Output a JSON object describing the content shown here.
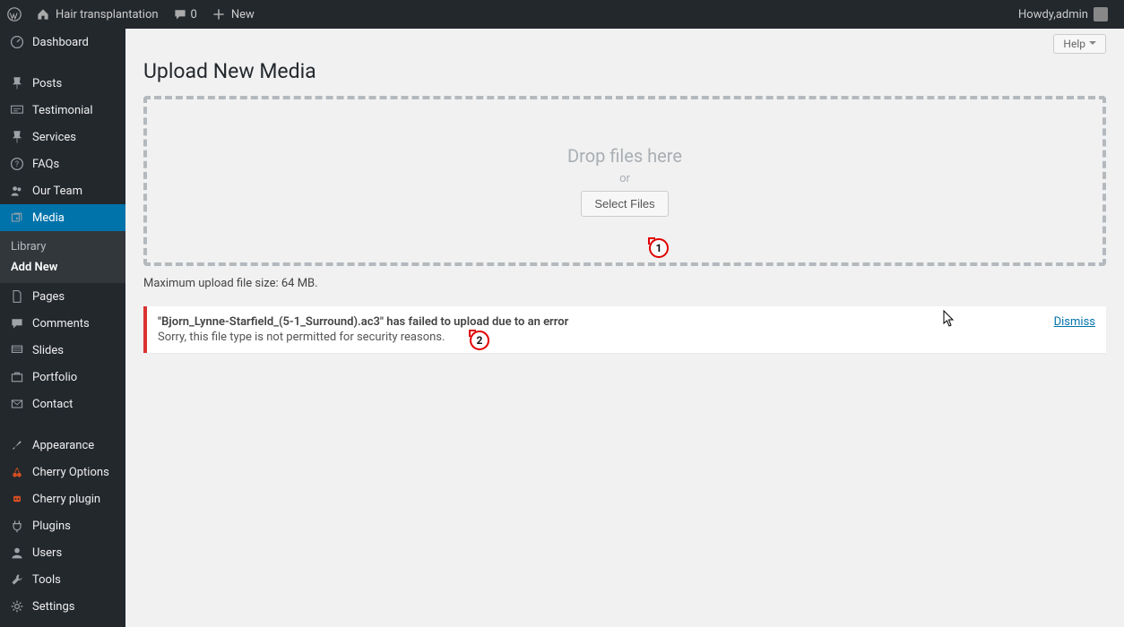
{
  "adminbar": {
    "site_name": "Hair transplantation",
    "comments_count": "0",
    "new_label": "New",
    "howdy_prefix": "Howdy, ",
    "username": "admin"
  },
  "sidebar": {
    "items": [
      {
        "label": "Dashboard",
        "icon": "dashboard"
      },
      {
        "sep": true
      },
      {
        "label": "Posts",
        "icon": "pin"
      },
      {
        "label": "Testimonial",
        "icon": "quote"
      },
      {
        "label": "Services",
        "icon": "pin"
      },
      {
        "label": "FAQs",
        "icon": "help"
      },
      {
        "label": "Our Team",
        "icon": "users"
      },
      {
        "label": "Media",
        "icon": "media",
        "current": true
      },
      {
        "label": "Pages",
        "icon": "page"
      },
      {
        "label": "Comments",
        "icon": "comment"
      },
      {
        "label": "Slides",
        "icon": "slides"
      },
      {
        "label": "Portfolio",
        "icon": "portfolio"
      },
      {
        "label": "Contact",
        "icon": "mail"
      },
      {
        "sep": true
      },
      {
        "label": "Appearance",
        "icon": "brush"
      },
      {
        "label": "Cherry Options",
        "icon": "cherry",
        "tint": "red"
      },
      {
        "label": "Cherry plugin",
        "icon": "cherryplug",
        "tint": "red"
      },
      {
        "label": "Plugins",
        "icon": "plug"
      },
      {
        "label": "Users",
        "icon": "user"
      },
      {
        "label": "Tools",
        "icon": "tools"
      },
      {
        "label": "Settings",
        "icon": "settings"
      }
    ],
    "submenu": [
      {
        "label": "Library"
      },
      {
        "label": "Add New",
        "current": true
      }
    ]
  },
  "page": {
    "help_label": "Help",
    "title": "Upload New Media",
    "dropzone_main": "Drop files here",
    "dropzone_or": "or",
    "select_files_label": "Select Files",
    "max_size_text": "Maximum upload file size: 64 MB."
  },
  "error": {
    "title": "\"Bjorn_Lynne-Starfield_(5-1_Surround).ac3\" has failed to upload due to an error",
    "message": "Sorry, this file type is not permitted for security reasons.",
    "dismiss_label": "Dismiss"
  },
  "annotations": {
    "a1": "1",
    "a2": "2"
  }
}
